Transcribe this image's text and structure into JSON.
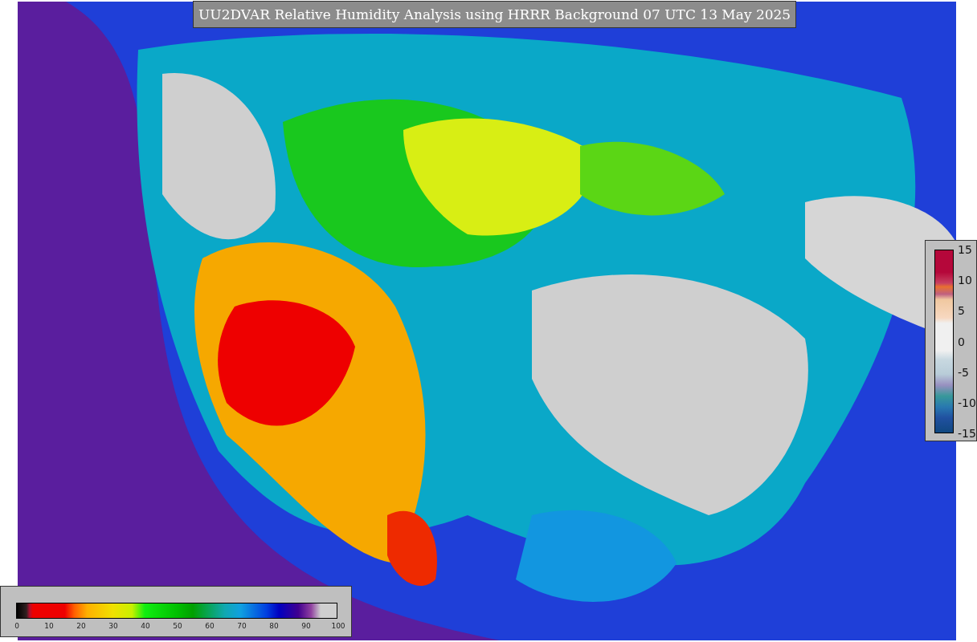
{
  "title": "UU2DVAR Relative Humidity Analysis using HRRR Background 07 UTC 13 May 2025",
  "humidity_legend": {
    "ticks": [
      "0",
      "10",
      "20",
      "30",
      "40",
      "50",
      "60",
      "70",
      "80",
      "90",
      "100"
    ]
  },
  "change_legend": {
    "ticks": [
      "15",
      "10",
      "5",
      "0",
      "-5",
      "-10",
      "-15"
    ]
  }
}
